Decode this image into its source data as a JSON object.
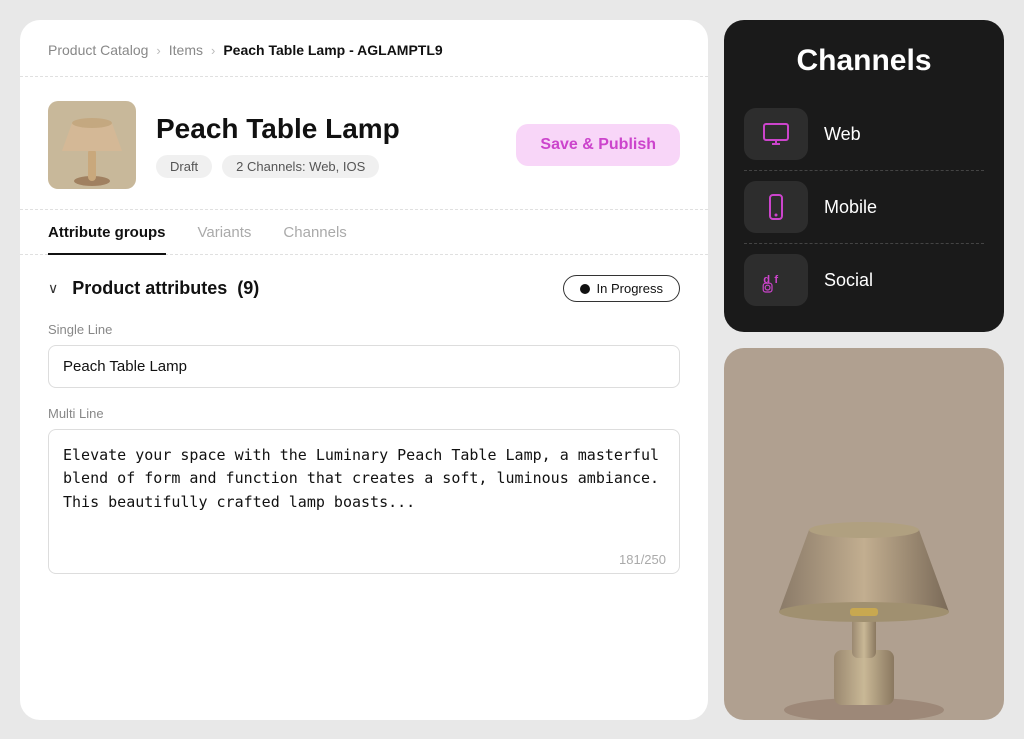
{
  "breadcrumb": {
    "catalog": "Product Catalog",
    "items": "Items",
    "current": "Peach Table Lamp - AGLAMPTL9"
  },
  "product": {
    "title": "Peach Table Lamp",
    "badges": {
      "status": "Draft",
      "channels": "2 Channels: Web, IOS"
    },
    "save_publish_label": "Save & Publish"
  },
  "tabs": [
    {
      "label": "Attribute groups",
      "active": true
    },
    {
      "label": "Variants",
      "active": false
    },
    {
      "label": "Channels",
      "active": false
    }
  ],
  "attributes_section": {
    "title": "Product attributes",
    "count": "(9)",
    "status_label": "In Progress"
  },
  "fields": {
    "single_line_label": "Single Line",
    "single_line_value": "Peach Table Lamp",
    "multi_line_label": "Multi Line",
    "multi_line_value": "Elevate your space with the Luminary Peach Table Lamp, a masterful blend of form and function that creates a soft, luminous ambiance. This beautifully crafted lamp boasts...",
    "char_count": "181/250"
  },
  "channels_panel": {
    "title": "Channels",
    "items": [
      {
        "name": "Web",
        "icon": "monitor"
      },
      {
        "name": "Mobile",
        "icon": "phone"
      },
      {
        "name": "Social",
        "icon": "social"
      }
    ]
  }
}
